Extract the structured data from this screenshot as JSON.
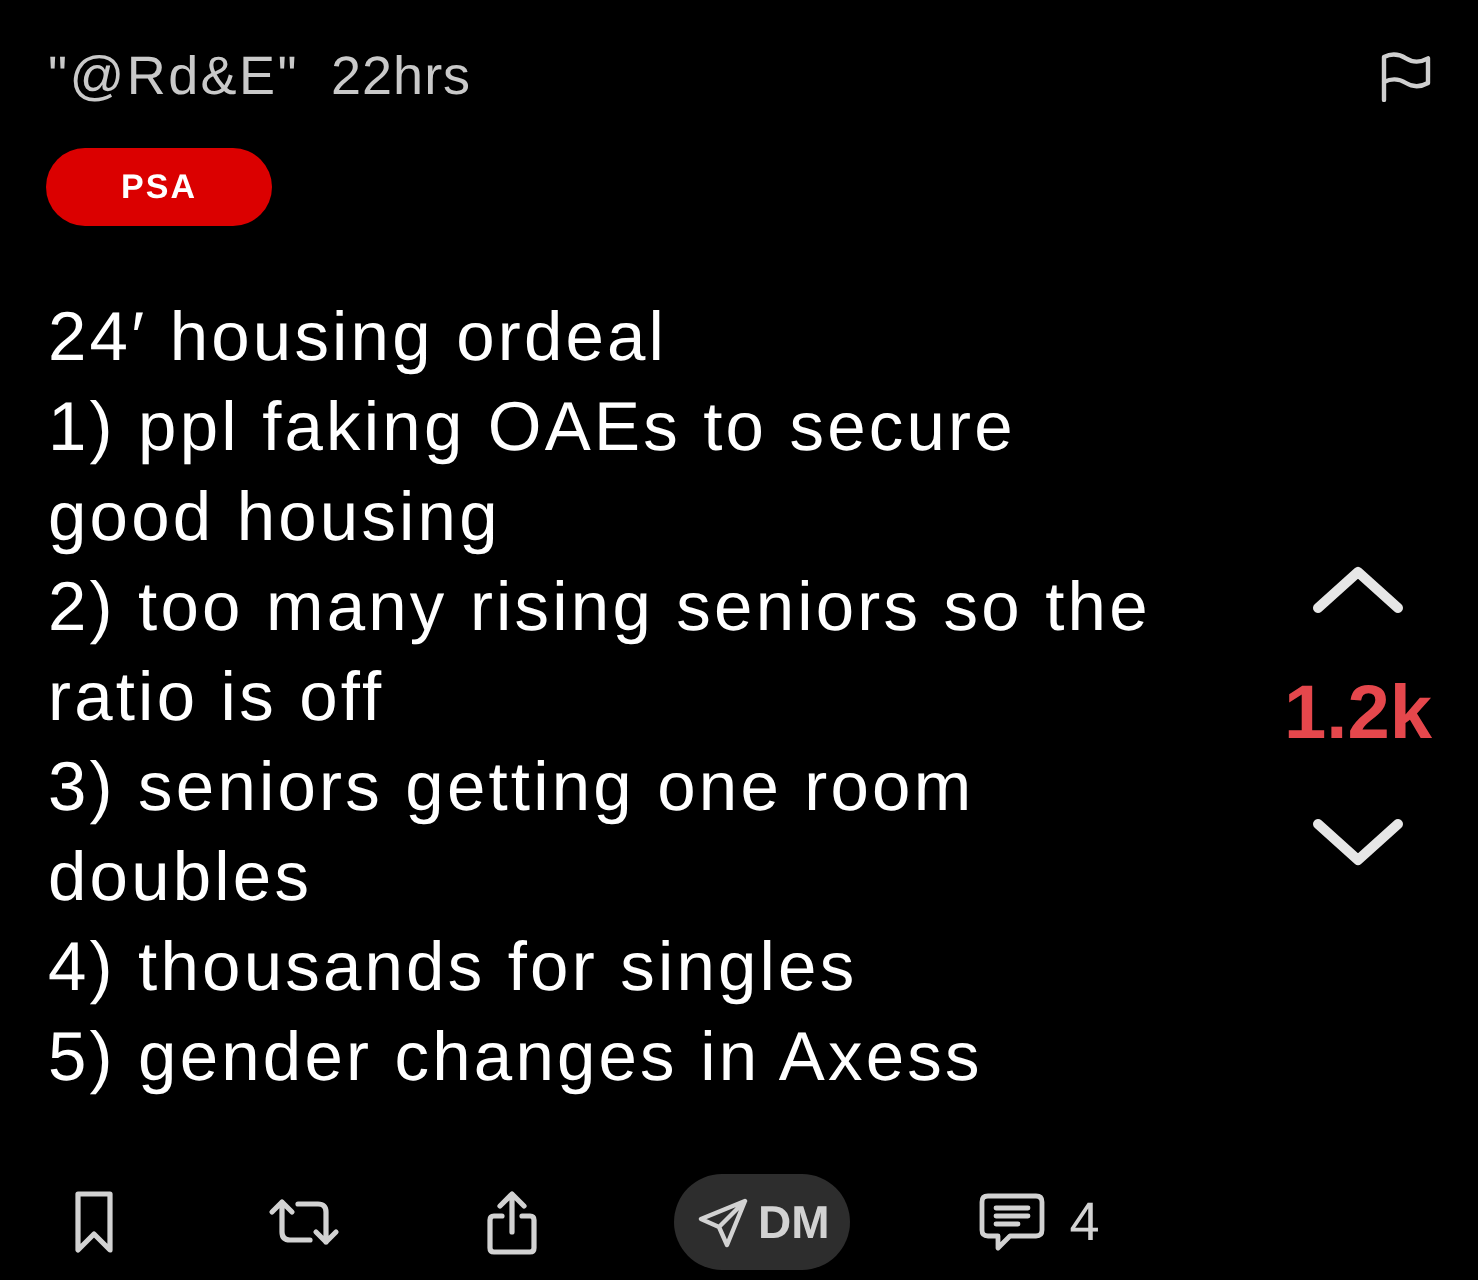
{
  "post": {
    "author": "\"@Rd&E\"",
    "time": "22hrs",
    "tag": "PSA",
    "body": [
      {
        "lines": [
          "24′ housing ordeal"
        ]
      },
      {
        "lines": [
          "1) ppl faking OAEs to secure",
          "good housing"
        ]
      },
      {
        "lines": [
          "2) too many rising seniors so the",
          "ratio is off"
        ]
      },
      {
        "lines": [
          "3) seniors getting one room",
          "doubles"
        ]
      },
      {
        "lines": [
          "4) thousands for singles"
        ]
      },
      {
        "lines": [
          "5) gender changes in Axess"
        ]
      }
    ]
  },
  "votes": {
    "count": "1.2k"
  },
  "actions": [
    {
      "kind": "bookmark"
    },
    {
      "kind": "repost"
    },
    {
      "kind": "share"
    },
    {
      "kind": "dm",
      "label": "DM"
    },
    {
      "kind": "comments",
      "count": "4"
    }
  ]
}
